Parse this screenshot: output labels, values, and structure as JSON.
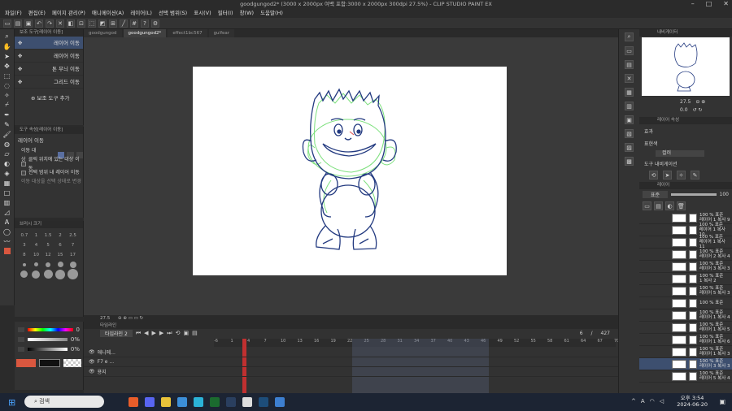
{
  "window": {
    "title": "goodgungod2* (3000 x 2000px 여백 포함:3000 x 2000px 300dpi 27.5%) - CLIP STUDIO PAINT EX"
  },
  "menu": [
    "파일(F)",
    "편집(E)",
    "페이지 관리(P)",
    "애니메이션(A)",
    "레이어(L)",
    "선택 범위(S)",
    "표시(V)",
    "필터(I)",
    "창(W)",
    "도움말(H)"
  ],
  "tabs": [
    "goodgungod",
    "goodgungod2*",
    "effect1bc567",
    "gulfear"
  ],
  "subtool": {
    "header": "보조 도구[레이어 이동]",
    "items": [
      "레이어 이동",
      "레이어 이동",
      "톤 무늬 이동",
      "그리드 이동"
    ],
    "add_label": "보조 도구 추가"
  },
  "toolprop": {
    "header": "도구 속성[레이어 이동]",
    "title": "레이어 이동",
    "target_label": "이동 대상",
    "opt1": "클릭 위치에 있는 대상 이동",
    "opt2": "선택 범위 내 레이어 이동",
    "opt3": "이동 대상을 선택 상태로 변경"
  },
  "brushsize": {
    "header": "브러시 크기",
    "sizes": [
      "0.7",
      "1",
      "1.5",
      "2",
      "2.5",
      "3",
      "4",
      "5",
      "6",
      "7",
      "8",
      "10",
      "12",
      "15",
      "17"
    ]
  },
  "color": {
    "main": "#d9573f",
    "sub": "#111111",
    "v1": "0",
    "v2": "0%",
    "v3": "0%"
  },
  "canvas_status": {
    "zoom": "27.5"
  },
  "timeline": {
    "header": "타임라인",
    "track_name": "타임라인 2",
    "frame_counter": "6",
    "frame_total": "427",
    "ruler": [
      "-6",
      "1",
      "4",
      "7",
      "10",
      "13",
      "16",
      "19",
      "22",
      "25",
      "28",
      "31",
      "34",
      "37",
      "40",
      "43",
      "46",
      "49",
      "52",
      "55",
      "58",
      "61",
      "64",
      "67",
      "70"
    ],
    "rows": [
      {
        "label": "애니메..."
      },
      {
        "label": "F7 e ..."
      },
      {
        "label": "용지"
      }
    ]
  },
  "navigator": {
    "header": "내비게이터",
    "zoom": "27.5",
    "angle": "0.0"
  },
  "effect": {
    "header": "레이어 속성",
    "effect_label": "효과",
    "color_label": "표현색",
    "color_value": "컬러",
    "nav_label": "도구 내비게이션"
  },
  "layers": {
    "header": "레이어",
    "blend": "표준",
    "opacity": "100",
    "items": [
      {
        "l1": "100 % 표준",
        "l2": "레이어 1 복사 9"
      },
      {
        "l1": "100 % 표준",
        "l2": "레이어 1 복사 10"
      },
      {
        "l1": "100 % 표준",
        "l2": "레이어 1 복사 11"
      },
      {
        "l1": "100 % 표준",
        "l2": "레이어 2 복사 4"
      },
      {
        "l1": "100 % 표준",
        "l2": "레이어 3 복사 3"
      },
      {
        "l1": "100 % 표준",
        "l2": "1 복사 2"
      },
      {
        "l1": "100 % 표준",
        "l2": "레이어 5 복사 3"
      },
      {
        "l1": "100 % 표준",
        "l2": ""
      },
      {
        "l1": "100 % 표준",
        "l2": "레이어 1 복사 4"
      },
      {
        "l1": "100 % 표준",
        "l2": "레이어 1 복사 5"
      },
      {
        "l1": "100 % 표준",
        "l2": "레이어 1 복사 6"
      },
      {
        "l1": "100 % 표준",
        "l2": "레이어 1 복사 3"
      },
      {
        "l1": "100 % 표준",
        "l2": "레이어 3 복사 3"
      },
      {
        "l1": "100 % 표준",
        "l2": "레이어 5 복사 4"
      }
    ]
  },
  "taskbar": {
    "search_placeholder": "검색",
    "time": "오후 3:54",
    "date": "2024-06-20"
  }
}
